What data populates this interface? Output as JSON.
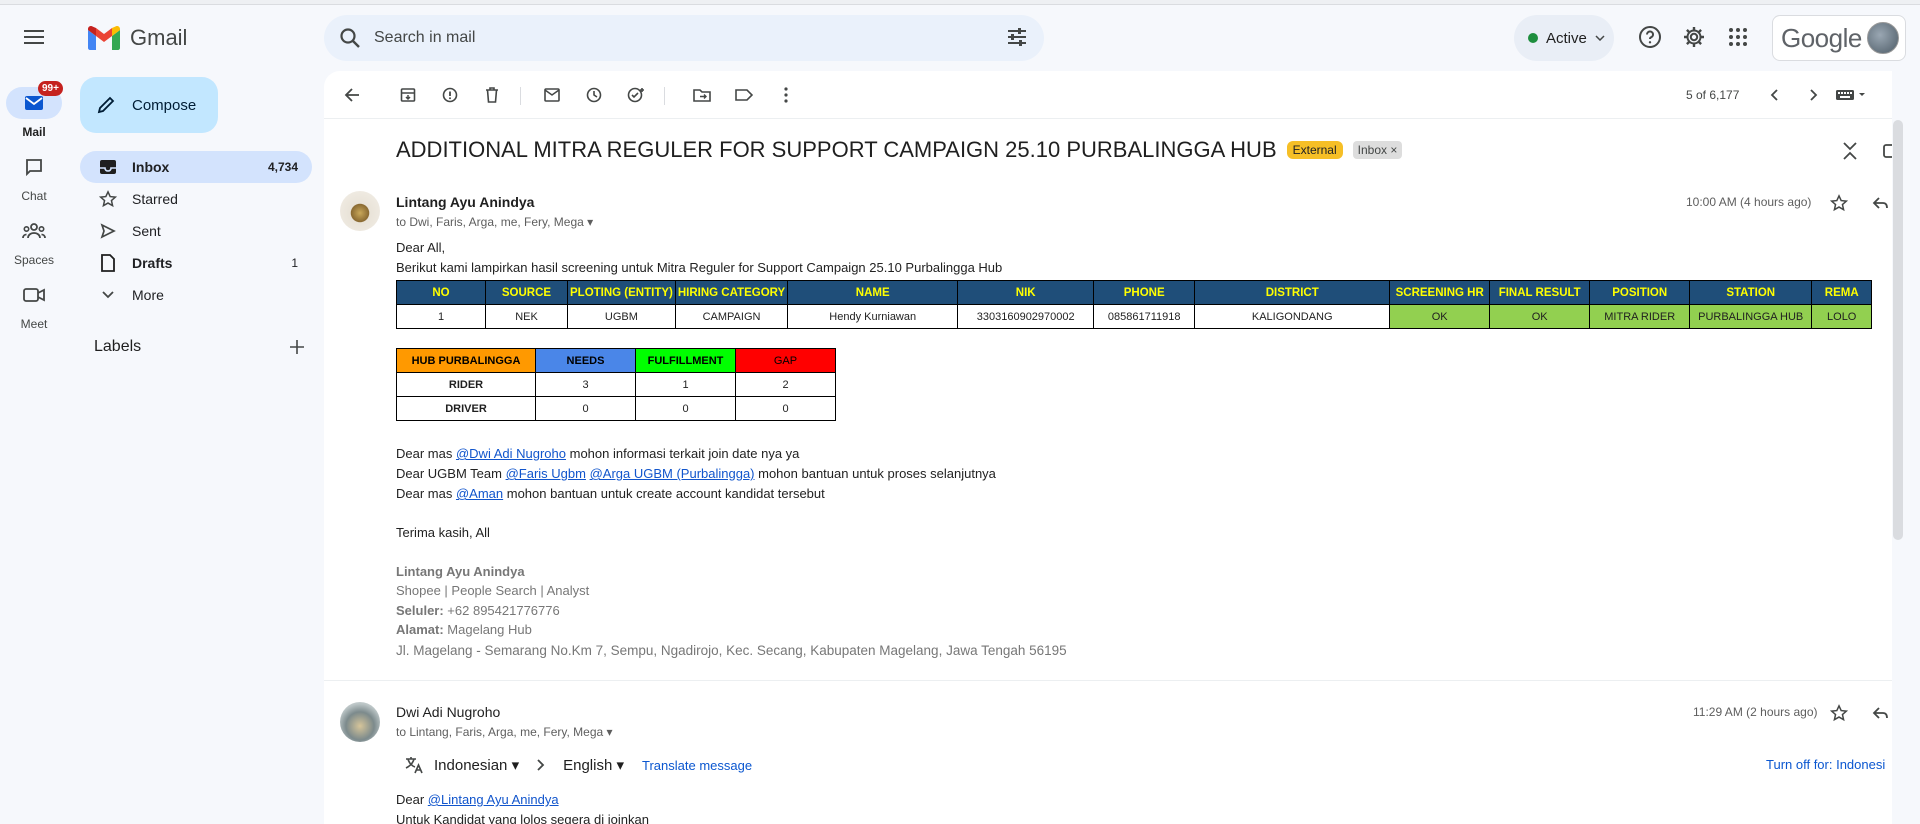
{
  "app": {
    "name": "Gmail"
  },
  "search": {
    "placeholder": "Search in mail"
  },
  "status": {
    "label": "Active"
  },
  "account": {
    "brand": "Google"
  },
  "rail": [
    {
      "label": "Mail",
      "badge": "99+"
    },
    {
      "label": "Chat"
    },
    {
      "label": "Spaces"
    },
    {
      "label": "Meet"
    }
  ],
  "compose": {
    "label": "Compose"
  },
  "nav": [
    {
      "label": "Inbox",
      "count": "4,734"
    },
    {
      "label": "Starred",
      "count": ""
    },
    {
      "label": "Sent",
      "count": ""
    },
    {
      "label": "Drafts",
      "count": "1"
    },
    {
      "label": "More",
      "count": ""
    }
  ],
  "labels": {
    "title": "Labels"
  },
  "pager": {
    "text": "5 of 6,177"
  },
  "thread": {
    "subject": "ADDITIONAL MITRA REGULER FOR SUPPORT CAMPAIGN 25.10 PURBALINGGA HUB",
    "tag_external": "External",
    "tag_inbox": "Inbox"
  },
  "msg1": {
    "sender": "Lintang Ayu Anindya",
    "to": "to Dwi, Faris, Arga, me, Fery, Mega",
    "time": "10:00 AM (4 hours ago)",
    "greeting": "Dear All,",
    "intro": "Berikut kami lampirkan hasil screening untuk Mitra Reguler for Support Campaign 25.10 Purbalingga Hub",
    "table_headers": [
      "NO",
      "SOURCE",
      "PLOTING (ENTITY)",
      "HIRING CATEGORY",
      "NAME",
      "NIK",
      "PHONE",
      "DISTRICT",
      "SCREENING HR",
      "FINAL RESULT",
      "POSITION",
      "STATION",
      "REMA"
    ],
    "table_row": [
      "1",
      "NEK",
      "UGBM",
      "CAMPAIGN",
      "Hendy Kurniawan",
      "3303160902970002",
      "085861711918",
      "KALIGONDANG",
      "OK",
      "OK",
      "MITRA RIDER",
      "PURBALINGGA HUB",
      "LOLO"
    ],
    "summary_headers": [
      "HUB PURBALINGGA",
      "NEEDS",
      "FULFILLMENT",
      "GAP"
    ],
    "summary_rows": [
      [
        "RIDER",
        "3",
        "1",
        "2"
      ],
      [
        "DRIVER",
        "0",
        "0",
        "0"
      ]
    ],
    "l1_pre": "Dear mas ",
    "l1_m1": "@Dwi Adi Nugroho",
    "l1_post": " mohon informasi terkait join date nya ya",
    "l2_pre": "Dear UGBM Team ",
    "l2_m1": "@Faris Ugbm",
    "l2_m2": "@Arga UGBM (Purbalingga)",
    "l2_post": " mohon bantuan untuk proses selanjutnya",
    "l3_pre": "Dear mas ",
    "l3_m1": "@Aman",
    "l3_post": " mohon bantuan untuk create account kandidat tersebut",
    "thanks": "Terima kasih, All",
    "sig_name": "Lintang Ayu Anindya",
    "sig_role": "Shopee | People Search | Analyst",
    "sig_phone_label": "Seluler:",
    "sig_phone": " +62 895421776776",
    "sig_addr_label": "Alamat:",
    "sig_addr": " Magelang Hub",
    "sig_street": "Jl. Magelang - Semarang No.Km 7, Sempu, Ngadirojo, Kec. Secang, Kabupaten Magelang, Jawa Tengah 56195"
  },
  "msg2": {
    "sender": "Dwi Adi Nugroho",
    "to": "to Lintang, Faris, Arga, me, Fery, Mega",
    "time": "11:29 AM (2 hours ago)",
    "from_lang": "Indonesian",
    "to_lang": "English",
    "translate": "Translate message",
    "turn_off": "Turn off for: Indonesi",
    "greet_pre": "Dear ",
    "greet_mention": "@Lintang Ayu Anindya",
    "line2": "Untuk Kandidat yang lolos segera di joinkan"
  },
  "colors": {
    "header_bg": "#1f4e79",
    "header_fg": "#ffff00",
    "ok_green": "#92d050",
    "hub_orange": "#ff9900",
    "needs_blue": "#4a86e8",
    "fulfill_green": "#00ff00",
    "gap_red": "#ff0000",
    "external_tag": "#f6bf26"
  }
}
